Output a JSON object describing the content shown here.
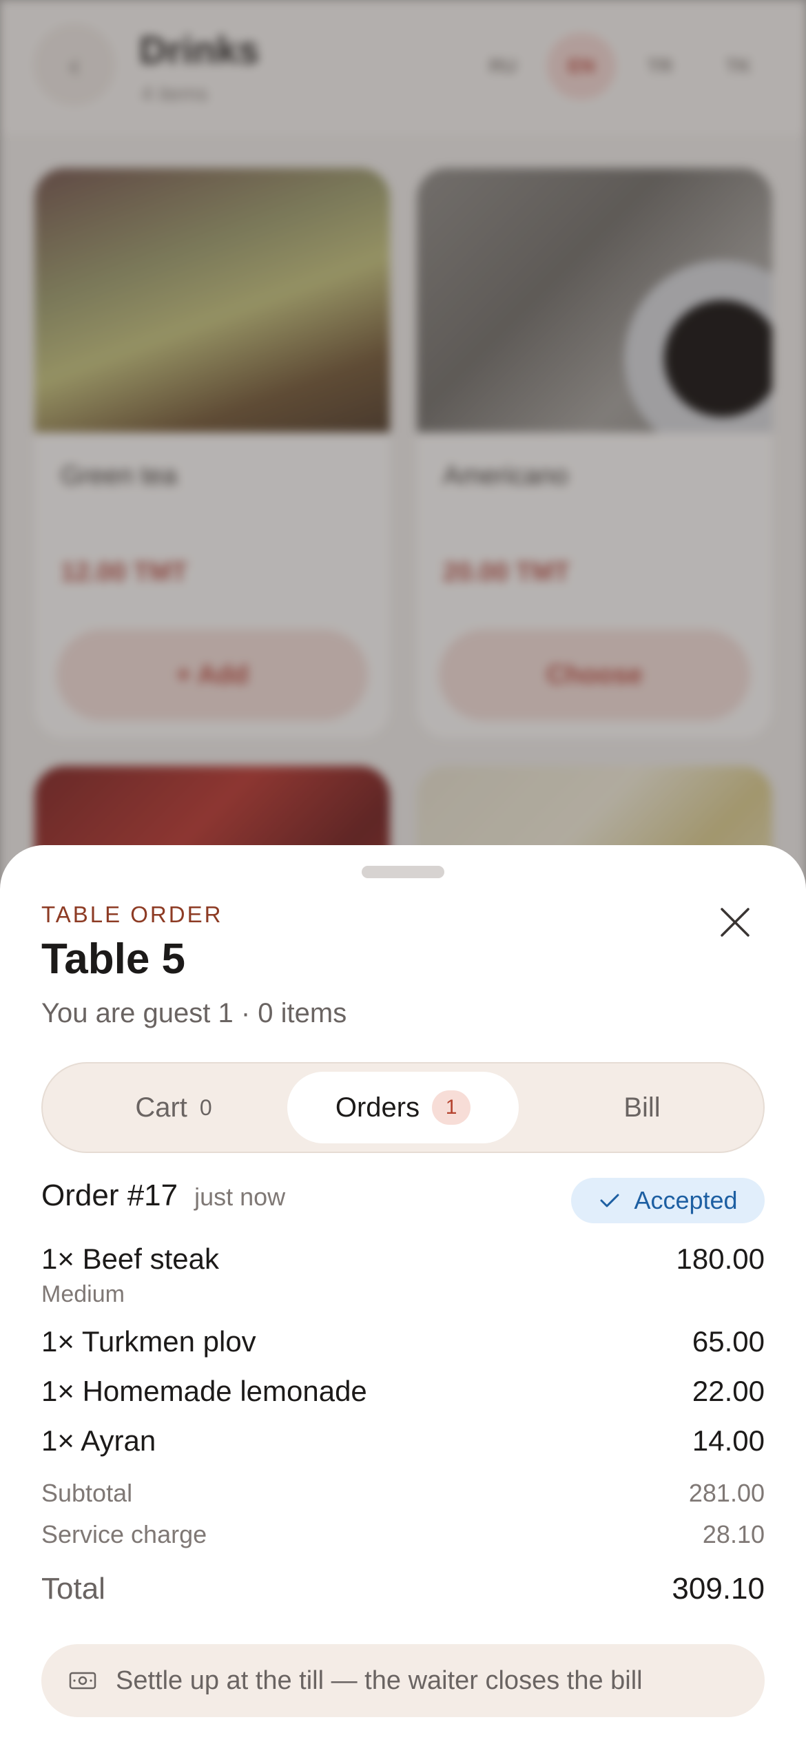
{
  "background": {
    "title": "Drinks",
    "subtitle": "4 items",
    "languages": [
      "RU",
      "EN",
      "TR",
      "TK"
    ],
    "active_language": "EN",
    "cards": [
      {
        "name": "Green tea",
        "price": "12.00 TMT",
        "button": "+ Add"
      },
      {
        "name": "Americano",
        "price": "20.00 TMT",
        "button": "Choose"
      }
    ]
  },
  "sheet": {
    "eyebrow": "TABLE ORDER",
    "title": "Table 5",
    "guest_line": "You are guest 1 · 0 items",
    "tabs": [
      {
        "label": "Cart",
        "count": "0"
      },
      {
        "label": "Orders",
        "count": "1"
      },
      {
        "label": "Bill"
      }
    ],
    "order": {
      "number": "Order #17",
      "time": "just now",
      "status": "Accepted",
      "items": [
        {
          "qty": "1×",
          "name": "Beef steak",
          "price": "180.00",
          "modifier": "Medium"
        },
        {
          "qty": "1×",
          "name": "Turkmen plov",
          "price": "65.00"
        },
        {
          "qty": "1×",
          "name": "Homemade lemonade",
          "price": "22.00"
        },
        {
          "qty": "1×",
          "name": "Ayran",
          "price": "14.00"
        }
      ],
      "subtotal_label": "Subtotal",
      "subtotal": "281.00",
      "service_label": "Service charge",
      "service": "28.10",
      "total_label": "Total",
      "total": "309.10"
    },
    "note": "Settle up at the till — the waiter closes the bill"
  },
  "colors": {
    "accent": "#8d3b24",
    "badge_bg": "#f7ddd7",
    "status_bg": "#e1eefb",
    "status_fg": "#1d5fa2"
  }
}
